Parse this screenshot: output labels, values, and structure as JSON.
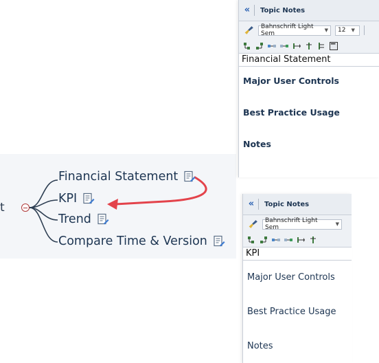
{
  "mindmap": {
    "root_partial": "t",
    "topics": [
      {
        "label": "Financial Statement"
      },
      {
        "label": "KPI"
      },
      {
        "label": "Trend"
      },
      {
        "label": "Compare Time & Version"
      }
    ]
  },
  "panels": {
    "top": {
      "header_title": "Topic Notes",
      "collapse_glyph": "«",
      "font_name": "Bahnschrift Light Sem",
      "font_size": "12",
      "topic_title": "Financial Statement",
      "sections": [
        "Major User Controls",
        "Best Practice Usage",
        "Notes"
      ]
    },
    "bottom": {
      "header_title": "Topic Notes",
      "collapse_glyph": "«",
      "font_name": "Bahnschrift Light Sem",
      "topic_title": "KPI",
      "sections": [
        "Major User Controls",
        "Best Practice Usage",
        "Notes"
      ]
    }
  },
  "colors": {
    "arrow": "#e3434b",
    "branch": "#2d3e52",
    "accent_blue": "#2c62b3"
  },
  "icons": [
    "note-icon",
    "broom-icon",
    "collapse-left-icon"
  ]
}
